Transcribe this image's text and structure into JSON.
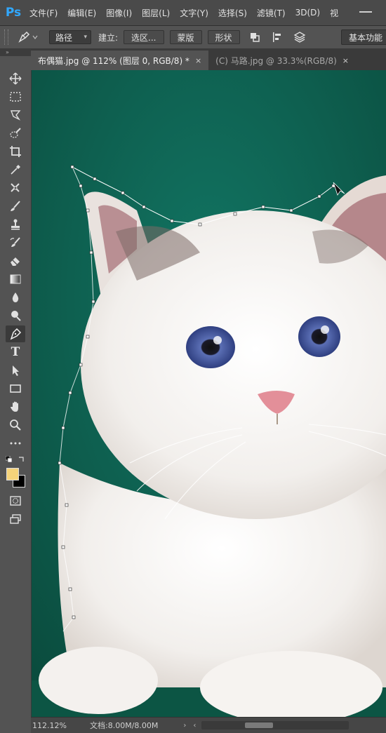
{
  "app": {
    "logo": "Ps",
    "menu": [
      "文件(F)",
      "编辑(E)",
      "图像(I)",
      "图层(L)",
      "文字(Y)",
      "选择(S)",
      "滤镜(T)",
      "3D(D)",
      "视"
    ]
  },
  "options": {
    "mode_value": "路径",
    "make_label": "建立:",
    "selection_btn": "选区...",
    "mask_btn": "蒙版",
    "shape_btn": "形状",
    "workspace_btn": "基本功能"
  },
  "collapse_arrows": "»",
  "tabs": [
    {
      "label": "布偶猫.jpg @ 112% (图层 0, RGB/8) *",
      "close": "×",
      "active": true
    },
    {
      "label": "(C) 马路.jpg @ 33.3%(RGB/8)",
      "close": "×",
      "active": false
    }
  ],
  "tools": [
    {
      "name": "move-tool",
      "icon": "move-icon"
    },
    {
      "name": "marquee-tool",
      "icon": "marquee-icon"
    },
    {
      "name": "lasso-tool",
      "icon": "lasso-icon"
    },
    {
      "name": "quick-select-tool",
      "icon": "quick-select-icon"
    },
    {
      "name": "crop-tool",
      "icon": "crop-icon"
    },
    {
      "name": "eyedropper-tool",
      "icon": "eyedropper-icon"
    },
    {
      "name": "healing-tool",
      "icon": "healing-icon"
    },
    {
      "name": "brush-tool",
      "icon": "brush-icon"
    },
    {
      "name": "stamp-tool",
      "icon": "stamp-icon"
    },
    {
      "name": "history-brush-tool",
      "icon": "history-brush-icon"
    },
    {
      "name": "eraser-tool",
      "icon": "eraser-icon"
    },
    {
      "name": "gradient-tool",
      "icon": "gradient-icon"
    },
    {
      "name": "blur-tool",
      "icon": "blur-icon"
    },
    {
      "name": "dodge-tool",
      "icon": "dodge-icon"
    },
    {
      "name": "pen-tool",
      "icon": "pen-icon",
      "active": true
    },
    {
      "name": "type-tool",
      "icon": "type-icon"
    },
    {
      "name": "path-select-tool",
      "icon": "path-select-icon"
    },
    {
      "name": "rectangle-tool",
      "icon": "rectangle-icon"
    },
    {
      "name": "hand-tool",
      "icon": "hand-icon"
    },
    {
      "name": "zoom-tool",
      "icon": "zoom-icon"
    },
    {
      "name": "more-tools",
      "icon": "ellipsis-icon"
    }
  ],
  "colors": {
    "foreground": "#f5d37a",
    "background": "#000000",
    "canvas_bg": "#0e5a49"
  },
  "type_glyph": "T",
  "status": {
    "zoom": "112.12%",
    "doc_info": "文档:8.00M/8.00M",
    "arrow": "›",
    "scroll_left": "‹"
  }
}
